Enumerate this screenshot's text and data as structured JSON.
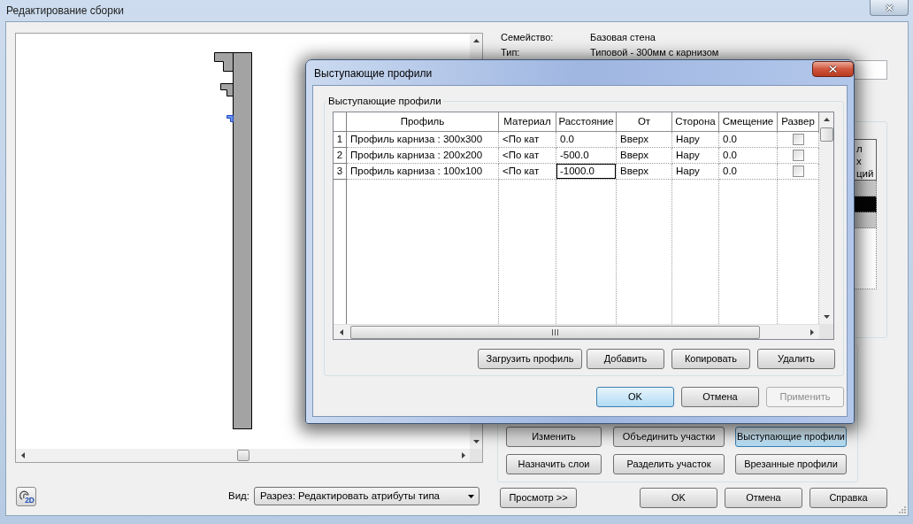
{
  "window": {
    "title": "Редактирование сборки"
  },
  "info": [
    {
      "label": "Семейство:",
      "value": "Базовая стена"
    },
    {
      "label": "Тип:",
      "value": "Типовой - 300мм с карнизом"
    }
  ],
  "layers_table": {
    "header_lines": [
      "л",
      "х",
      "ций"
    ],
    "rows": [
      {
        "kind": "boundary",
        "selected": false
      },
      {
        "kind": "layer",
        "selected": true
      },
      {
        "kind": "boundary",
        "selected": false
      }
    ]
  },
  "preview": {
    "view_toggle": "2D",
    "view_label": "Вид:",
    "view_value": "Разрез: Редактировать атрибуты типа"
  },
  "layer_buttons": [
    {
      "label": "Изменить",
      "focused": false
    },
    {
      "label": "Объединить участки",
      "focused": false
    },
    {
      "label": "Выступающие профили",
      "focused": true
    },
    {
      "label": "Назначить слои",
      "focused": false
    },
    {
      "label": "Разделить участок",
      "focused": false
    },
    {
      "label": "Врезанные профили",
      "focused": false
    }
  ],
  "preview_button": "Просмотр >>",
  "footer_buttons": [
    "OK",
    "Отмена",
    "Справка"
  ],
  "dialog": {
    "title": "Выступающие профили",
    "group_label": "Выступающие профили",
    "table": {
      "columns": [
        "Профиль",
        "Материал",
        "Расстояние",
        "От",
        "Сторона",
        "Смещение",
        "Развер"
      ],
      "rows": [
        {
          "number": "1",
          "cells": [
            {
              "text": "Профиль карниза : 300x300",
              "focused": false
            },
            {
              "text": "<По кат",
              "focused": false
            },
            {
              "text": "0.0",
              "focused": false
            },
            {
              "text": "Вверх",
              "focused": false
            },
            {
              "text": "Нару",
              "focused": false
            },
            {
              "text": "0.0",
              "focused": false
            }
          ],
          "checked": false
        },
        {
          "number": "2",
          "cells": [
            {
              "text": "Профиль карниза : 200x200",
              "focused": false
            },
            {
              "text": "<По кат",
              "focused": false
            },
            {
              "text": "-500.0",
              "focused": false
            },
            {
              "text": "Вверх",
              "focused": false
            },
            {
              "text": "Нару",
              "focused": false
            },
            {
              "text": "0.0",
              "focused": false
            }
          ],
          "checked": false
        },
        {
          "number": "3",
          "cells": [
            {
              "text": "Профиль карниза : 100x100",
              "focused": false
            },
            {
              "text": "<По кат",
              "focused": false
            },
            {
              "text": "-1000.0",
              "focused": true
            },
            {
              "text": "Вверх",
              "focused": false
            },
            {
              "text": "Нару",
              "focused": false
            },
            {
              "text": "0.0",
              "focused": false
            }
          ],
          "checked": false
        }
      ]
    },
    "action_buttons": [
      "Загрузить профиль",
      "Добавить",
      "Копировать",
      "Удалить"
    ],
    "buttons": [
      {
        "label": "OK",
        "default": true,
        "disabled": false
      },
      {
        "label": "Отмена",
        "default": false,
        "disabled": false
      },
      {
        "label": "Применить",
        "default": false,
        "disabled": true
      }
    ]
  }
}
